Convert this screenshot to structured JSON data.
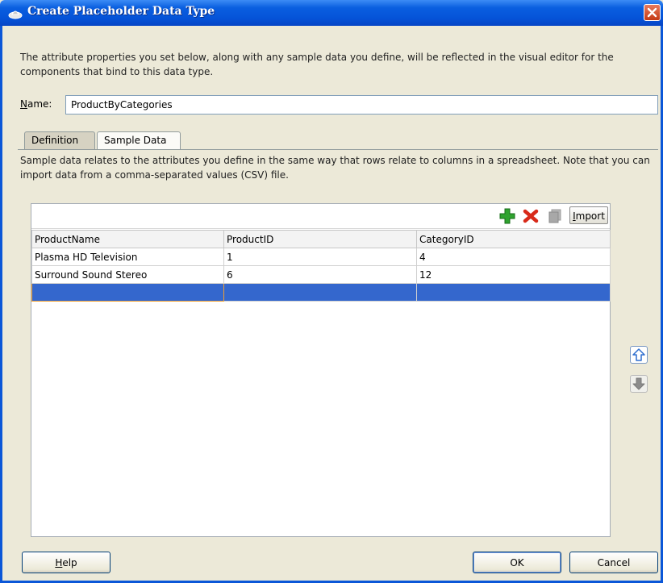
{
  "dialog": {
    "title": "Create Placeholder Data Type",
    "description": "The attribute properties you set below, along with any sample data you define, will be reflected in the visual editor for the components that bind to this data type."
  },
  "name": {
    "label_accesskey": "N",
    "label_rest": "ame:",
    "value": "ProductByCategories"
  },
  "tabs": [
    {
      "label": "Definition",
      "selected": false
    },
    {
      "label": "Sample Data",
      "selected": true
    }
  ],
  "sample": {
    "description": "Sample data relates to the attributes you define in the same way that rows relate to columns in a spreadsheet. Note that you can import data from a comma-separated values (CSV) file.",
    "toolbar": {
      "add_icon": "add-row-icon",
      "delete_icon": "delete-row-icon",
      "copy_icon": "copy-icon",
      "import_accesskey": "I",
      "import_rest": "mport"
    },
    "columns": [
      "ProductName",
      "ProductID",
      "CategoryID"
    ],
    "rows": [
      [
        "Plasma HD Television",
        "1",
        "4"
      ],
      [
        "Surround Sound Stereo",
        "6",
        "12"
      ],
      [
        "",
        "",
        ""
      ]
    ]
  },
  "buttons": {
    "help_accesskey": "H",
    "help_rest": "elp",
    "ok": "OK",
    "cancel": "Cancel"
  },
  "colors": {
    "titlebar": "#0553d8",
    "selection": "#3467cd",
    "add": "#2fa32f",
    "delete": "#d82a1a"
  }
}
